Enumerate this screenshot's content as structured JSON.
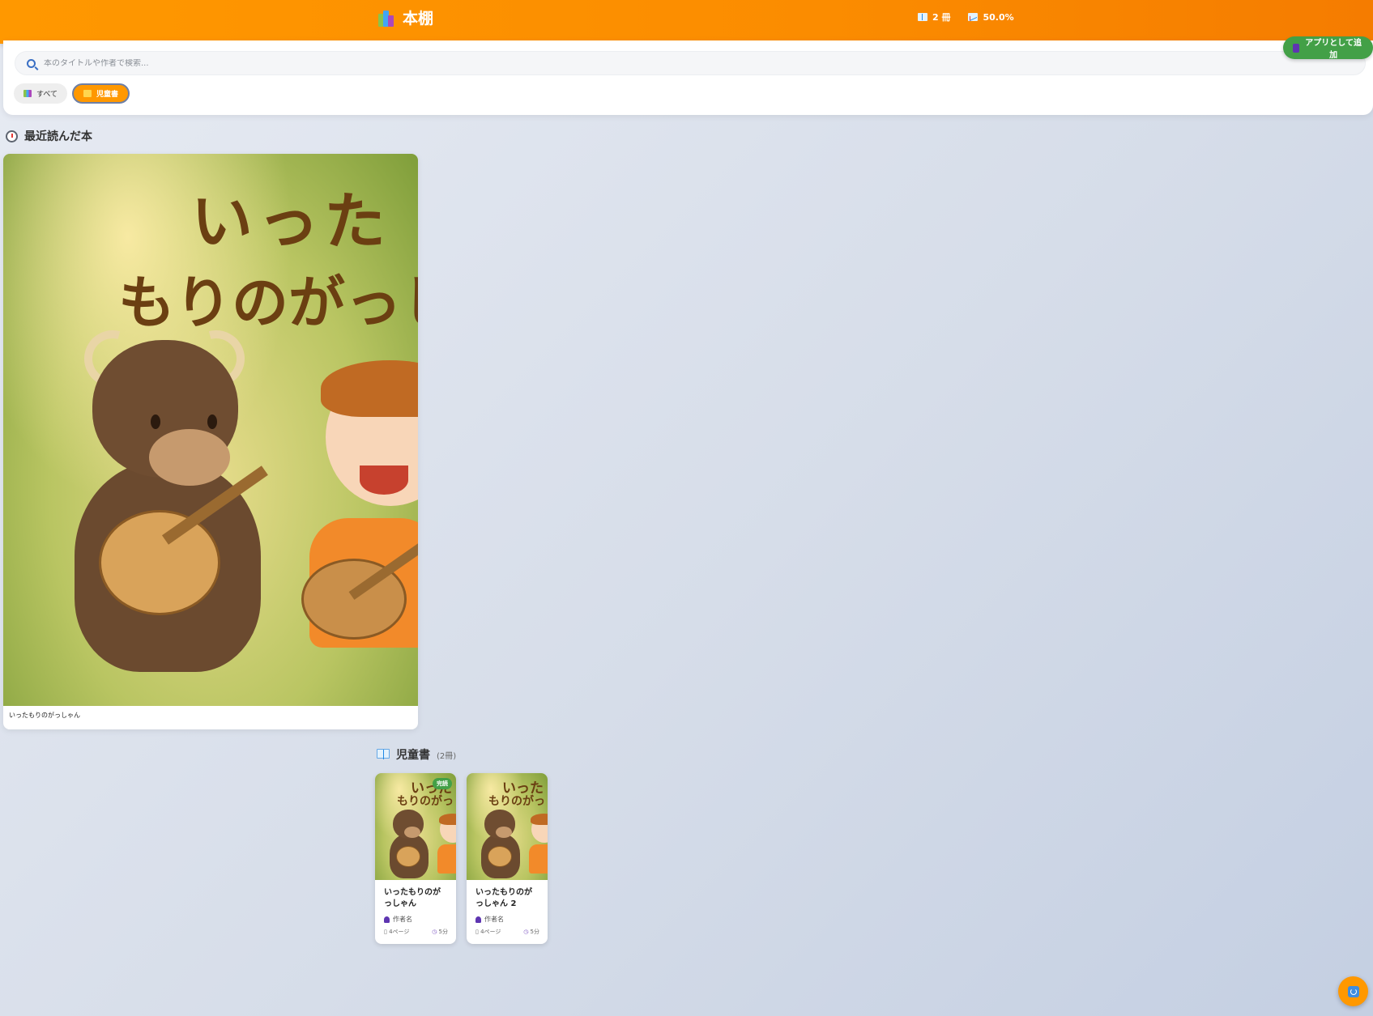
{
  "header": {
    "title": "本棚",
    "stats": {
      "book_count": "2 冊",
      "progress": "50.0%"
    }
  },
  "install_button": {
    "label": "アプリとして追加"
  },
  "search": {
    "placeholder": "本のタイトルや作者で検索..."
  },
  "filters": [
    {
      "label": "すべて",
      "active": false
    },
    {
      "label": "児童書",
      "active": true
    }
  ],
  "recent": {
    "heading": "最近読んだ本",
    "book": {
      "title": "いったもりのがっしゃん",
      "cover_text_line1": "いった",
      "cover_text_line2": "もりのがっし"
    }
  },
  "category": {
    "name": "児童書",
    "count": "(2冊)",
    "books": [
      {
        "title": "いったもりのがっしゃん",
        "author": "作者名",
        "pages": "4ページ",
        "time": "5分",
        "badge": "完読",
        "cover_text_line1": "いった",
        "cover_text_line2": "もりのがっし"
      },
      {
        "title": "いったもりのがっしゃん 2",
        "author": "作者名",
        "pages": "4ページ",
        "time": "5分",
        "badge": "",
        "cover_text_line1": "いった",
        "cover_text_line2": "もりのがっし"
      }
    ]
  },
  "colors": {
    "accent": "#ff9800",
    "success": "#43a047",
    "background": "#dde3ee"
  },
  "icons": [
    "books-logo-icon",
    "book-icon",
    "chart-icon",
    "install-icon",
    "search-icon",
    "all-books-icon",
    "folder-icon",
    "clock-icon",
    "person-icon",
    "page-icon",
    "timer-icon",
    "refresh-icon"
  ]
}
